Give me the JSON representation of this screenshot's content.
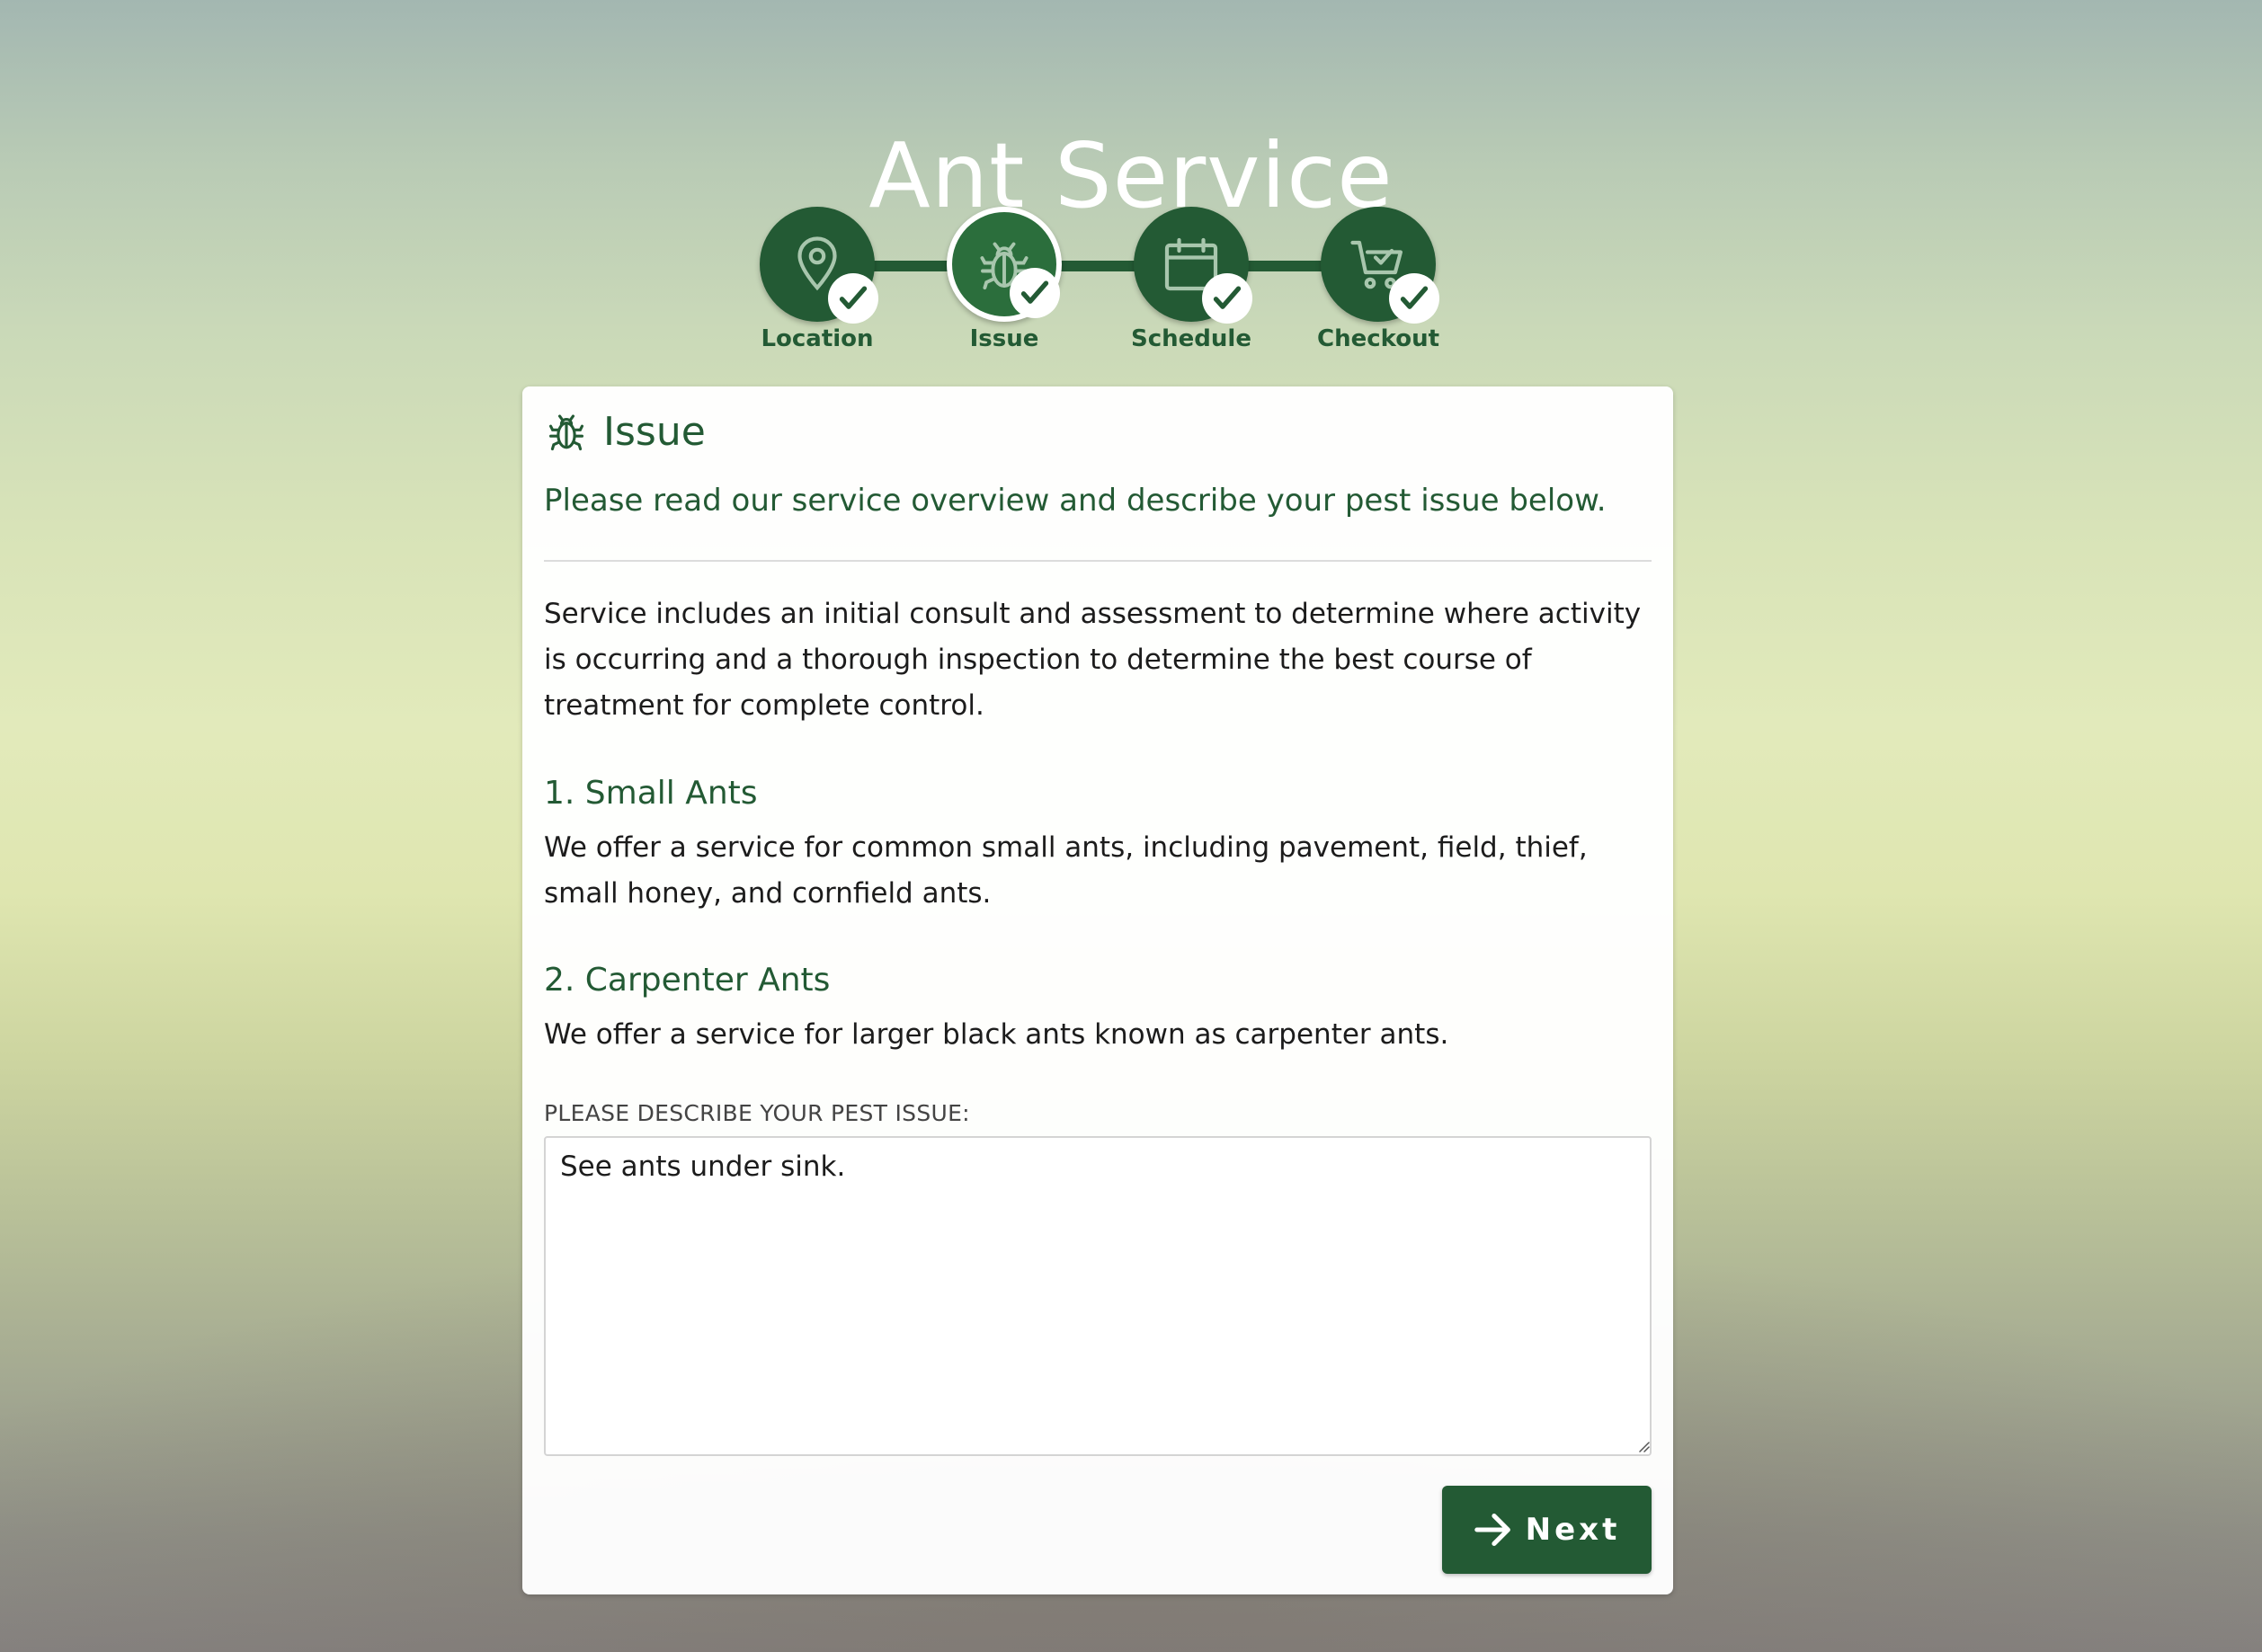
{
  "page": {
    "title": "Ant Service"
  },
  "stepper": {
    "steps": [
      {
        "label": "Location",
        "icon": "map-pin-icon",
        "completed": true,
        "active": false
      },
      {
        "label": "Issue",
        "icon": "bug-icon",
        "completed": true,
        "active": true
      },
      {
        "label": "Schedule",
        "icon": "calendar-icon",
        "completed": true,
        "active": false
      },
      {
        "label": "Checkout",
        "icon": "cart-icon",
        "completed": true,
        "active": false
      }
    ]
  },
  "card": {
    "header_icon": "bug-icon",
    "title": "Issue",
    "subtitle": "Please read our service overview and describe your pest issue below.",
    "overview": "Service includes an initial consult and assessment to determine where activity is occurring and a thorough inspection to determine the best course of treatment for complete control.",
    "sections": [
      {
        "heading": "1. Small Ants",
        "body": "We offer a service for common small ants, including pavement, field, thief, small honey, and cornfield ants."
      },
      {
        "heading": "2. Carpenter Ants",
        "body": "We offer a service for larger black ants known as carpenter ants."
      }
    ],
    "field_label": "PLEASE DESCRIBE YOUR PEST ISSUE:",
    "field_value": "See ants under sink.",
    "next_label": "Next"
  },
  "colors": {
    "brand_green": "#235a34",
    "active_step_green": "#2b6e3c",
    "text_dark": "#1c1c1c"
  }
}
